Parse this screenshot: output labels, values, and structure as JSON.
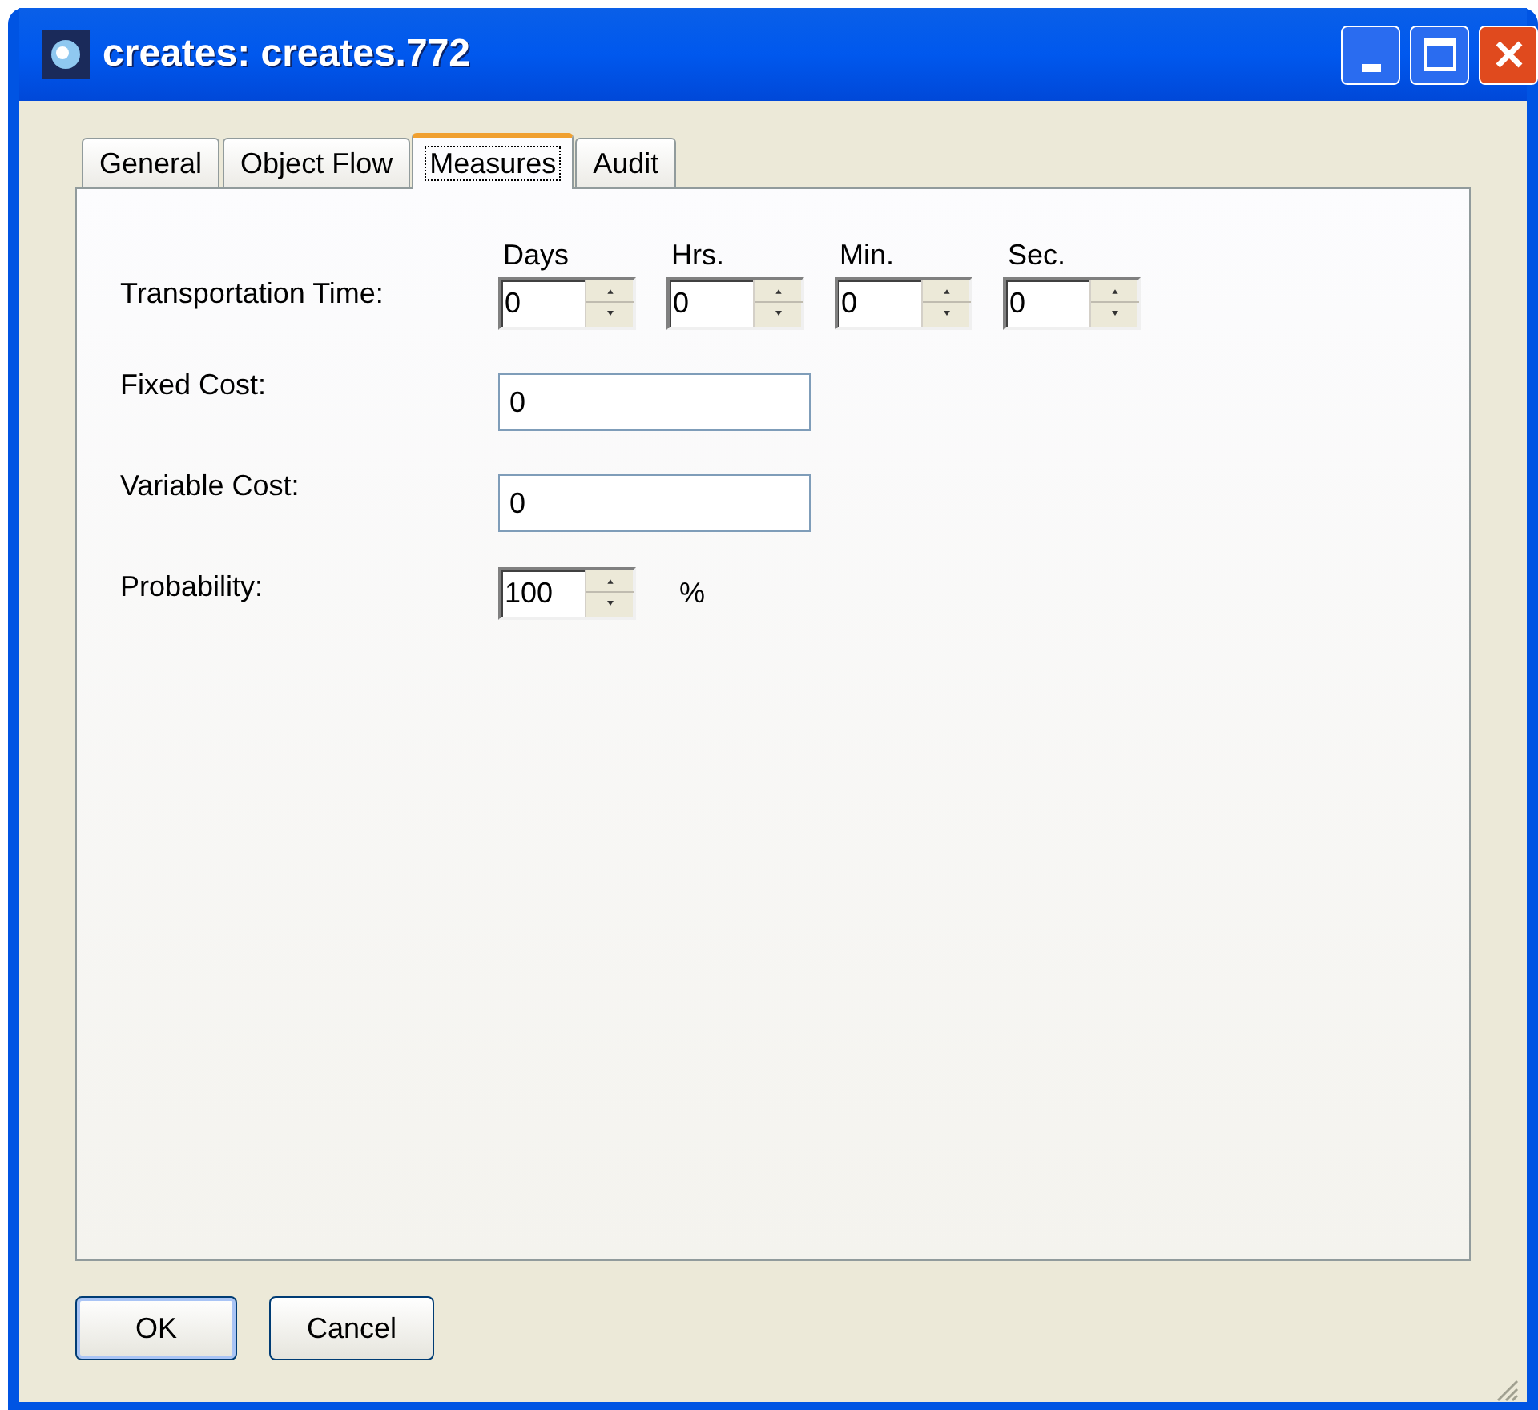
{
  "window": {
    "title": "creates: creates.772"
  },
  "tabs": [
    {
      "label": "General",
      "selected": false
    },
    {
      "label": "Object Flow",
      "selected": false
    },
    {
      "label": "Measures",
      "selected": true
    },
    {
      "label": "Audit",
      "selected": false
    }
  ],
  "transportation_time": {
    "label": "Transportation Time:",
    "units": [
      {
        "header": "Days",
        "value": "0"
      },
      {
        "header": "Hrs.",
        "value": "0"
      },
      {
        "header": "Min.",
        "value": "0"
      },
      {
        "header": "Sec.",
        "value": "0"
      }
    ]
  },
  "fields": [
    {
      "kind": "text",
      "label": "Fixed Cost:",
      "value": "0"
    },
    {
      "kind": "text",
      "label": "Variable Cost:",
      "value": "0"
    },
    {
      "kind": "spinner",
      "label": "Probability:",
      "value": "100",
      "unit": "%"
    }
  ],
  "buttons": [
    {
      "label": "OK",
      "default": true
    },
    {
      "label": "Cancel",
      "default": false
    }
  ]
}
